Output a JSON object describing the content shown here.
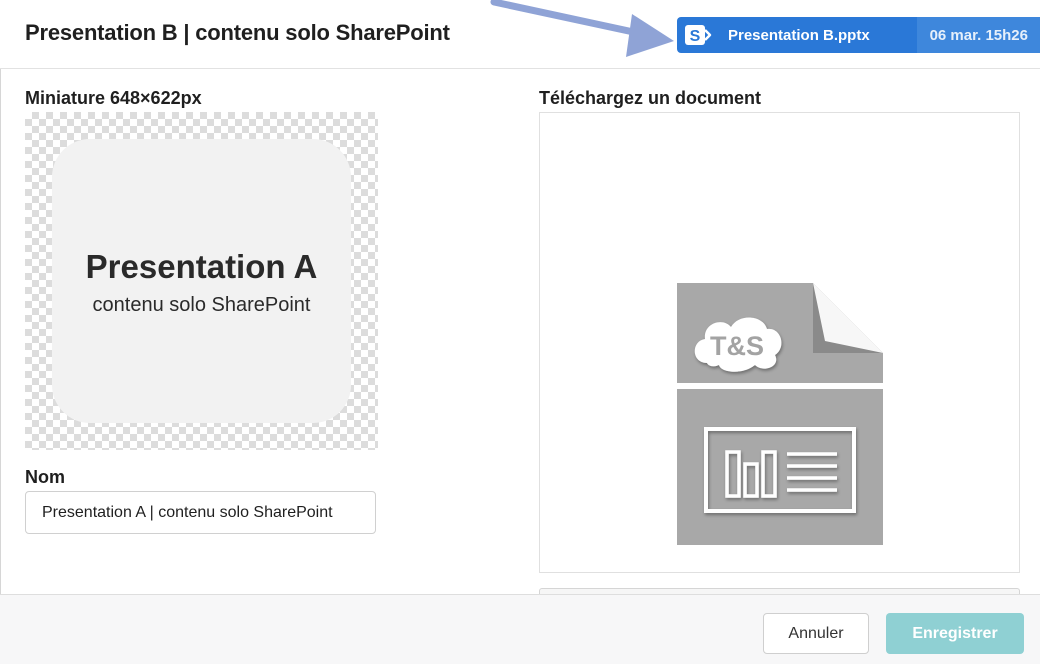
{
  "header": {
    "title": "Presentation B | contenu solo SharePoint",
    "file_chip": {
      "icon": "sharepoint-icon",
      "filename": "Presentation B.pptx",
      "date": "06 mar. 15h26",
      "color": "#2a78d7"
    }
  },
  "thumbnail": {
    "label": "Miniature 648×622px",
    "title": "Presentation A",
    "subtitle": "contenu solo SharePoint"
  },
  "name_field": {
    "label": "Nom",
    "value": "Presentation A | contenu solo SharePoint"
  },
  "upload": {
    "label": "Téléchargez un document",
    "doc_badge": "T&S",
    "icon": "presentation-file-icon"
  },
  "footer": {
    "cancel_label": "Annuler",
    "save_label": "Enregistrer",
    "save_color": "#8fd0d3"
  }
}
